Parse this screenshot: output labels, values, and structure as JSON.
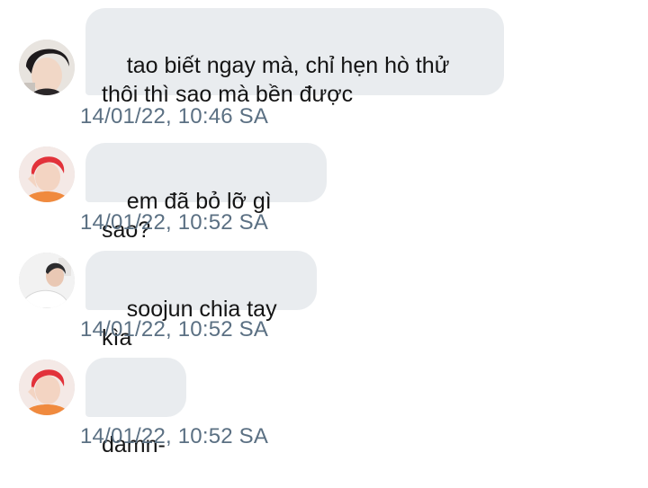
{
  "messages": [
    {
      "text": "tao biết ngay mà, chỉ hẹn hò thử\nthôi thì sao mà bền được",
      "timestamp": "14/01/22, 10:46 SA",
      "avatar": "avatar-dark-hair"
    },
    {
      "text": "em đã bỏ lỡ gì sao?",
      "timestamp": "14/01/22, 10:52 SA",
      "avatar": "avatar-red-hair"
    },
    {
      "text": "soojun chia tay kìa",
      "timestamp": "14/01/22, 10:52 SA",
      "avatar": "avatar-white-shirt"
    },
    {
      "text": "damn-",
      "timestamp": "14/01/22, 10:52 SA",
      "avatar": "avatar-red-hair"
    }
  ],
  "colors": {
    "bubble": "#e9ecef",
    "timestamp": "#5b7083",
    "text": "#141414"
  }
}
